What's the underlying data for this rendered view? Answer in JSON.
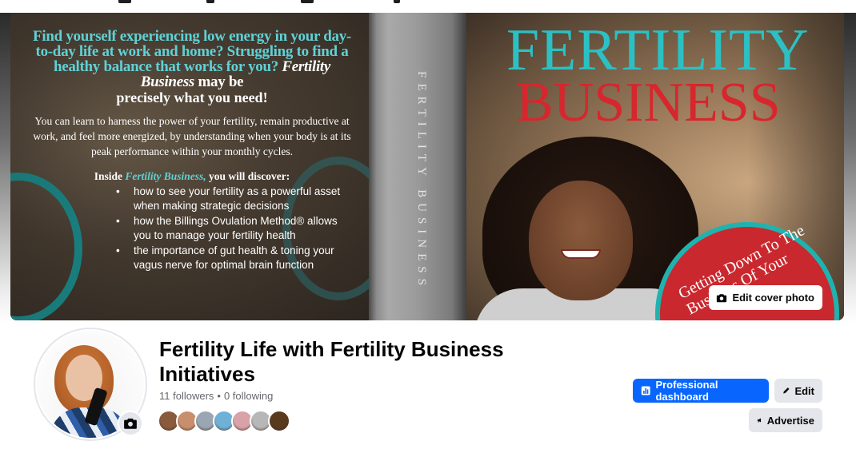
{
  "cover": {
    "edit_cover_label": "Edit cover photo",
    "back_cover": {
      "headline": "Find yourself experiencing low energy in your day-to-day life at work and home? Struggling to find a healthy balance that works for you?",
      "headline_em": "Fertility Business",
      "headline_tail": "may be",
      "subhead": "precisely what you need!",
      "body": "You can learn to harness the power of your fertility, remain productive at work, and feel more energized, by understanding when your body is at its peak performance within your monthly cycles.",
      "inside_prefix": "Inside",
      "inside_em": "Fertility Business,",
      "inside_suffix": "you will discover:",
      "bullets": [
        "how to see your fertility as a powerful asset when making strategic decisions",
        "how the Billings Ovulation Method® allows you to manage your fertility health",
        "the importance of gut health & toning your vagus nerve for optimal brain function"
      ]
    },
    "spine_text": "FERTILITY BUSINESS",
    "front_cover": {
      "title_line1": "FERTILITY",
      "title_line2": "BUSINESS",
      "seal_text": "Getting Down To The Business Of Your"
    }
  },
  "profile": {
    "name": "Fertility Life with Fertility Business Initiatives",
    "followers": "11 followers",
    "separator": "•",
    "following": "0 following",
    "follower_avatar_colors": [
      "#8a5a3c",
      "#c98e6b",
      "#9aa6b2",
      "#6fb0d6",
      "#d9a1a8",
      "#b7b7b7",
      "#5a3a1c"
    ]
  },
  "actions": {
    "professional_dashboard": "Professional dashboard",
    "edit": "Edit",
    "advertise": "Advertise"
  },
  "colors": {
    "primary": "#0866ff",
    "secondary_button": "#e4e6eb",
    "accent_teal": "#2bc1c4",
    "accent_red": "#d7262d"
  }
}
